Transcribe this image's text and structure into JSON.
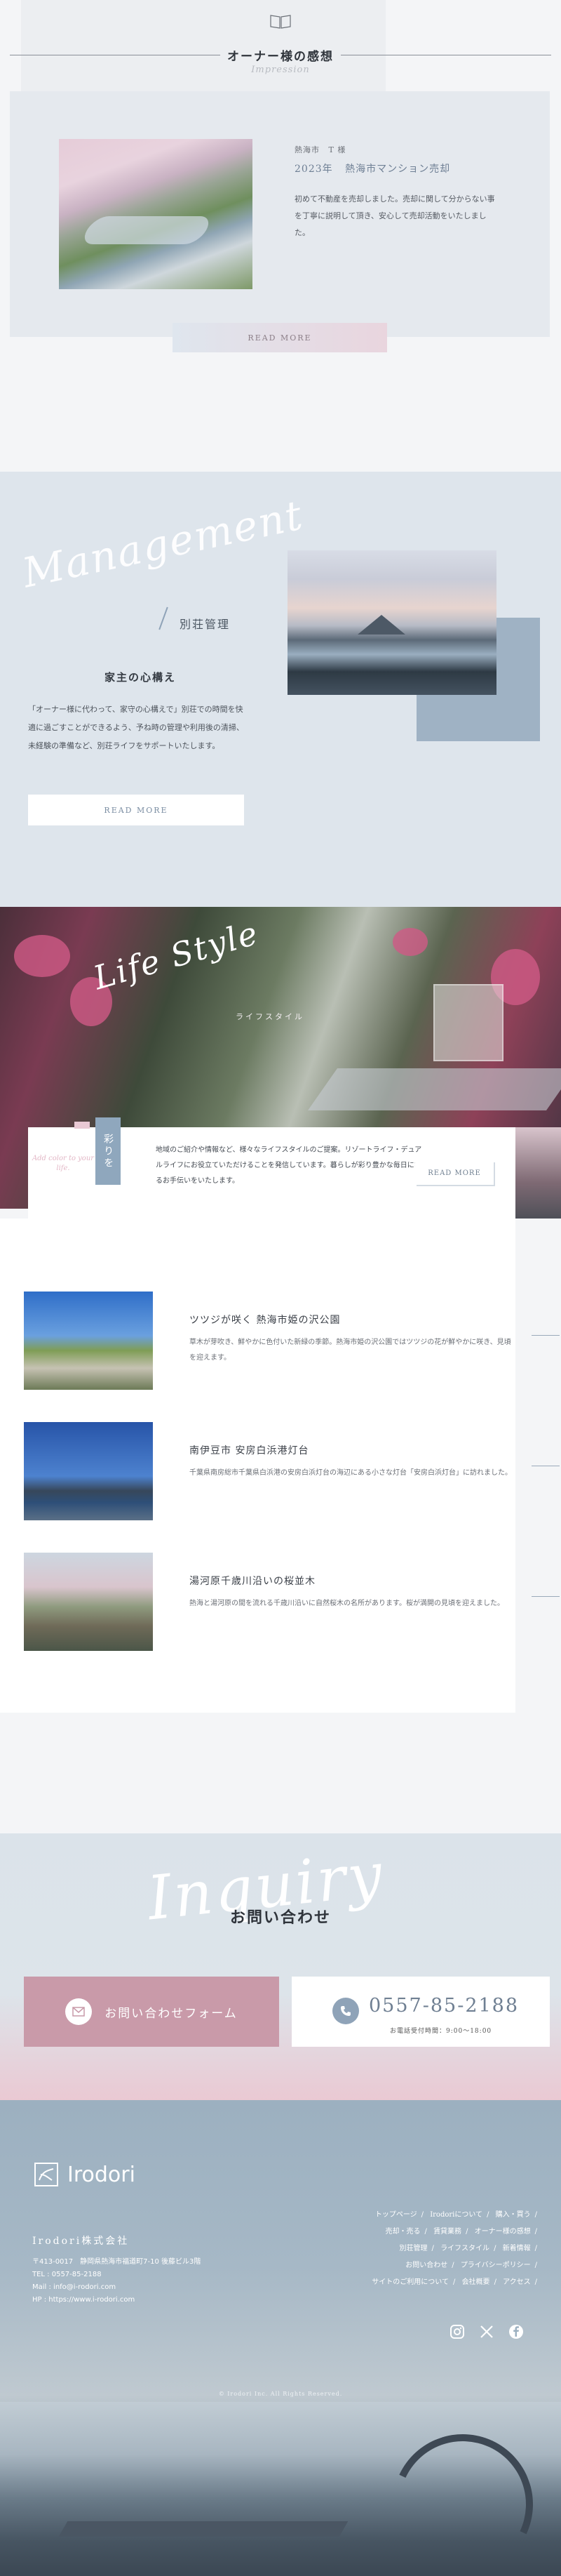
{
  "voice": {
    "title": "オーナー様の感想",
    "subtitle": "Impression",
    "meta": [
      "熱海市",
      "T 様"
    ],
    "year": "2023年",
    "property": "熱海市マンション売却",
    "body": "初めて不動産を売却しました。売却に関して分からない事を丁寧に説明して頂き、安心して売却活動をいたしました。",
    "read_more": "READ MORE"
  },
  "management": {
    "script": "Management",
    "title": "別荘管理",
    "heading": "家主の心構え",
    "body": "「オーナー様に代わって、家守の心構えで」別荘での時間を快適に過ごすことができるよう、予ね時の管理や利用後の清掃、未経験の準備など、別荘ライフをサポートいたします。",
    "read_more": "READ MORE"
  },
  "lifestyle": {
    "script": "Life Style",
    "subtitle": "ライフスタイル",
    "tag": "彩りを",
    "side_script": "Add color to your life.",
    "body": "地域のご紹介や情報など、様々なライフスタイルのご提案。リゾートライフ・デュアルライフにお役立ていただけることを発信しています。暮らしが彩り豊かな毎日になるお手伝いをいたします。",
    "read_more": "READ MORE"
  },
  "articles": [
    {
      "title": "ツツジが咲く 熱海市姫の沢公園",
      "desc": "草木が芽吹き、鮮やかに色付いた新緑の季節。熱海市姫の沢公園ではツツジの花が鮮やかに咲き、見頃を迎えます。"
    },
    {
      "title": "南伊豆市 安房白浜港灯台",
      "desc": "千葉県南房総市千葉県白浜港の安房白浜灯台の海辺にある小さな灯台「安房白浜灯台」に訪れました。"
    },
    {
      "title": "湯河原千歳川沿いの桜並木",
      "desc": "熱海と湯河原の間を流れる千歳川沿いに自然桜木の名所があります。桜が満開の見頃を迎えました。"
    }
  ],
  "inquiry": {
    "script": "Inquiry",
    "title": "お問い合わせ",
    "form_button": "お問い合わせフォーム",
    "phone": "0557-85-2188",
    "hours": "お電話受付時間：9:00～18:00"
  },
  "footer": {
    "logo": "Irodori",
    "company": "Irodori株式会社",
    "address": "〒413-0017　静岡県熱海市福道町7-10 後藤ビル3階",
    "tel": "TEL : 0557-85-2188",
    "mail": "Mail : info@i-rodori.com",
    "hp": "HP : https://www.i-rodori.com",
    "nav": [
      [
        "トップページ",
        "Irodoriについて",
        "購入・買う"
      ],
      [
        "売却・売る",
        "賃貸業務",
        "オーナー様の感想"
      ],
      [
        "別荘管理",
        "ライフスタイル",
        "新着情報"
      ],
      [
        "お問い合わせ",
        "プライバシーポリシー"
      ],
      [
        "サイトのご利用について",
        "会社概要",
        "アクセス"
      ]
    ],
    "copyright": "© Irodori Inc. All Rights Reserved."
  }
}
